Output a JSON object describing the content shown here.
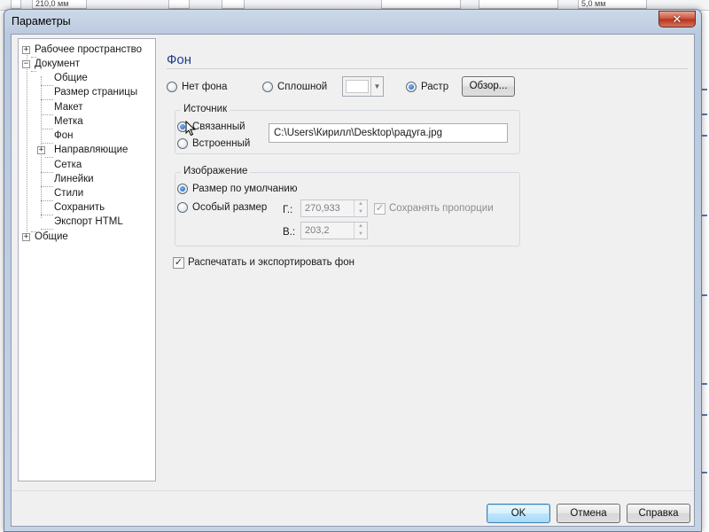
{
  "background": {
    "ruler_width": "210,0 мм",
    "nudge": "5,0 мм"
  },
  "window": {
    "title": "Параметры",
    "close_label": "✕"
  },
  "tree": {
    "items": [
      {
        "label": "Рабочее пространство",
        "expander": "+"
      },
      {
        "label": "Документ",
        "expander": "−"
      },
      {
        "label": "Общие"
      },
      {
        "label": "Размер страницы"
      },
      {
        "label": "Макет"
      },
      {
        "label": "Метка"
      },
      {
        "label": "Фон"
      },
      {
        "label": "Направляющие",
        "expander": "+"
      },
      {
        "label": "Сетка"
      },
      {
        "label": "Линейки"
      },
      {
        "label": "Стили"
      },
      {
        "label": "Сохранить"
      },
      {
        "label": "Экспорт HTML"
      },
      {
        "label": "Общие",
        "expander": "+"
      }
    ]
  },
  "page": {
    "title": "Фон",
    "no_background": "Нет фона",
    "solid": "Сплошной",
    "raster": "Растр",
    "browse": "Обзор...",
    "source": {
      "title": "Источник",
      "linked": "Связанный",
      "embedded": "Встроенный",
      "path": "C:\\Users\\Кирилл\\Desktop\\радуга.jpg"
    },
    "image": {
      "title": "Изображение",
      "default_size": "Размер по умолчанию",
      "custom_size": "Особый размер",
      "h_label": "Г.:",
      "h_value": "270,933",
      "v_label": "В.:",
      "v_value": "203,2",
      "keep_ratio": "Сохранять пропорции"
    },
    "print_export": "Распечатать и экспортировать фон"
  },
  "buttons": {
    "ok": "OK",
    "cancel": "Отмена",
    "help": "Справка"
  },
  "colors": {
    "accent": "#1f3c88",
    "default_button": "#3c7fb1",
    "close_button": "#c9503a"
  }
}
